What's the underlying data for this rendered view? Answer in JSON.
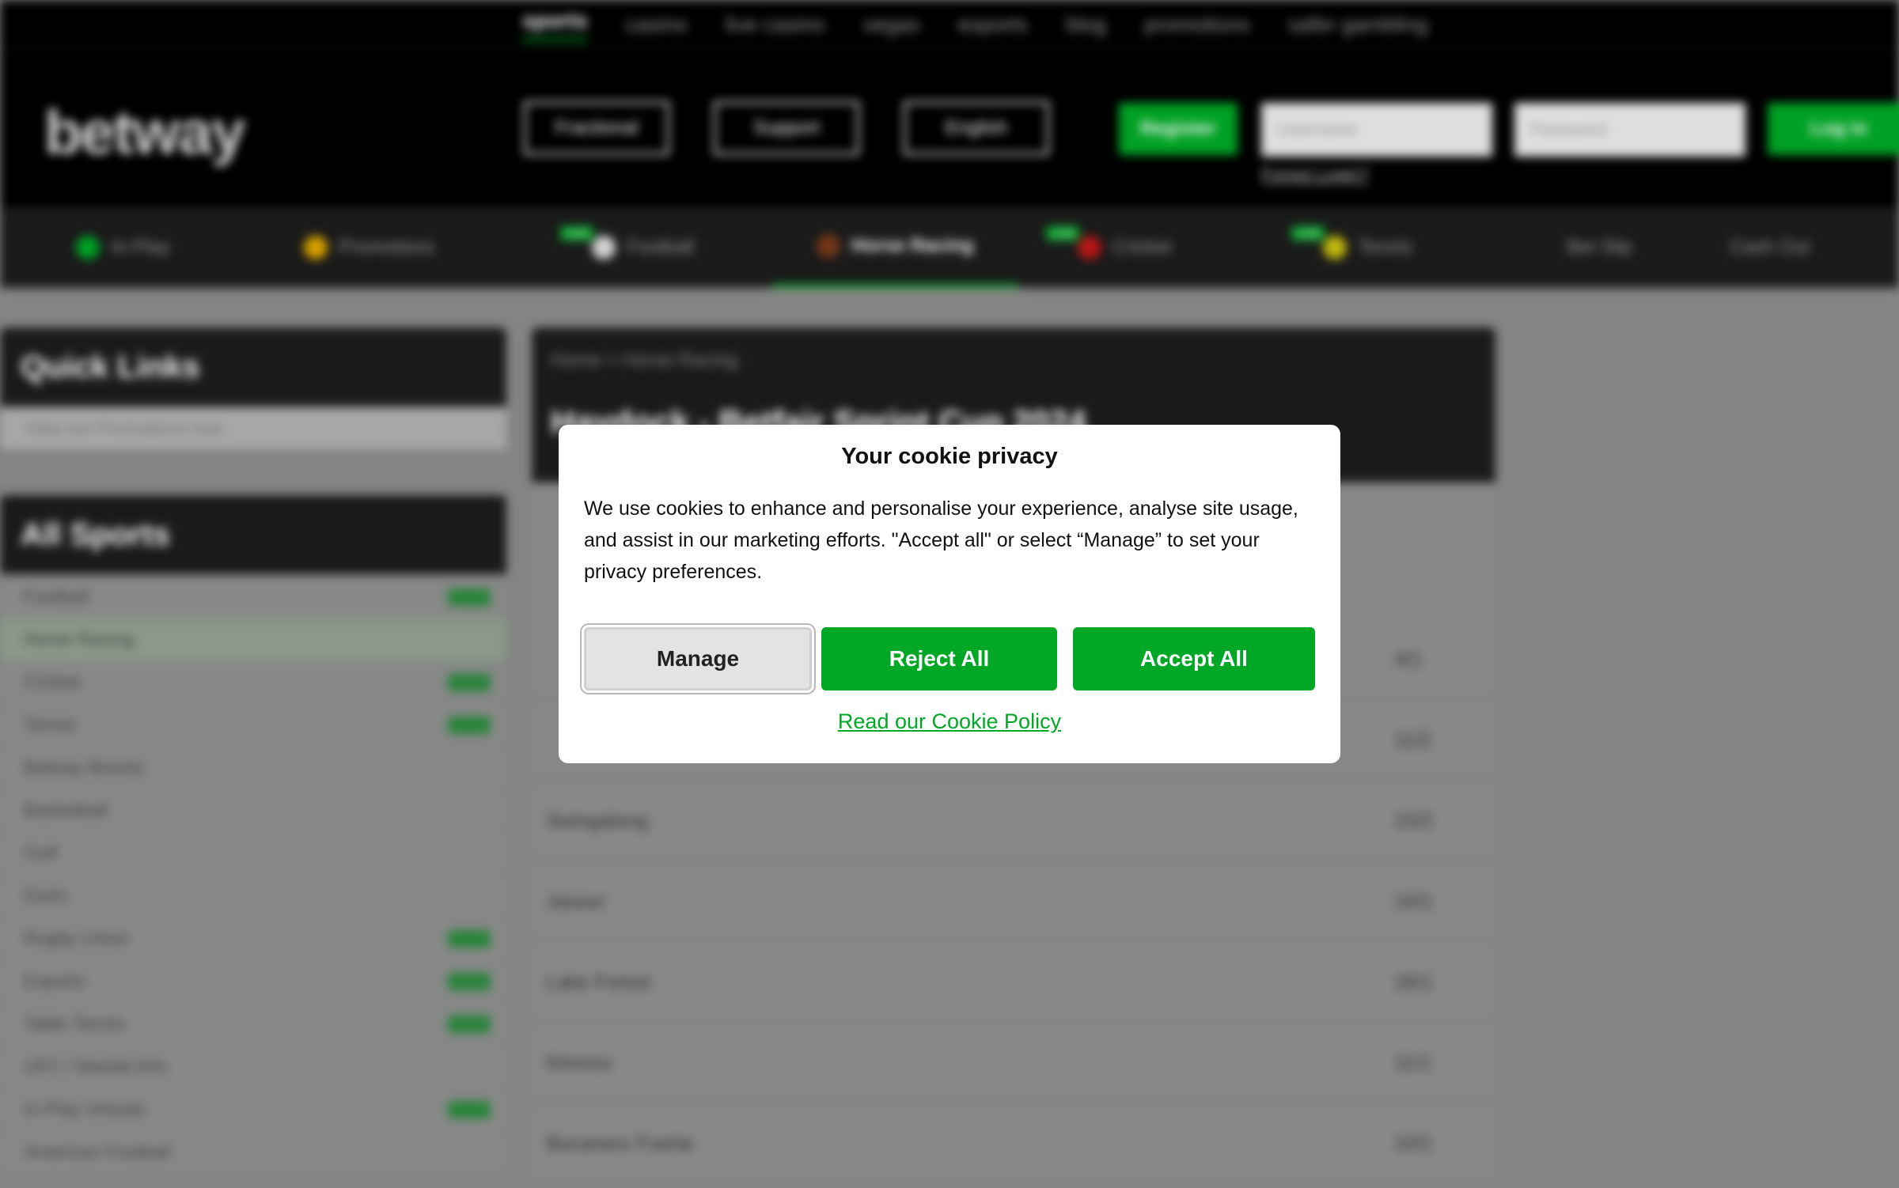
{
  "top_nav": [
    "sports",
    "casino",
    "live casino",
    "vegas",
    "esports",
    "blog",
    "promotions",
    "safer gambling"
  ],
  "header": {
    "logo": "betway",
    "odds_format": "Fractional",
    "support": "Support",
    "language": "English",
    "register": "Register",
    "username_placeholder": "Username",
    "password_placeholder": "Password",
    "login": "Log in",
    "forgot": "Forgot Login?"
  },
  "sports_bar": [
    "In-Play",
    "Promotions",
    "Football",
    "Horse Racing",
    "Cricket",
    "Tennis",
    "Bet Slip",
    "Cash Out"
  ],
  "live_badge": "LIVE",
  "quick_links": {
    "title": "Quick Links",
    "item": "View our Promotions now"
  },
  "all_sports": {
    "title": "All Sports",
    "items": [
      "Football",
      "Horse Racing",
      "Cricket",
      "Tennis",
      "Betway Boosts",
      "Basketball",
      "Golf",
      "Darts",
      "Rugby Union",
      "Esports",
      "Table Tennis",
      "UFC / Martial Arts",
      "In-Play Virtuals",
      "American Football"
    ]
  },
  "main": {
    "breadcrumb": "Home  >  Horse Racing",
    "title": "Haydock - Betfair Sprint Cup 2024",
    "runners": [
      {
        "name": "",
        "odds": "4/1"
      },
      {
        "name": "",
        "odds": "11/2"
      },
      {
        "name": "Swingalong",
        "odds": "15/2"
      },
      {
        "name": "Jasour",
        "odds": "10/1"
      },
      {
        "name": "Lake Forest",
        "odds": "16/1"
      },
      {
        "name": "Kinross",
        "odds": "11/1"
      },
      {
        "name": "Bucanero Fuerte",
        "odds": "10/1"
      }
    ]
  },
  "cookie_modal": {
    "title": "Your cookie privacy",
    "body": "We use cookies to enhance and personalise your experience, analyse site usage, and assist in our marketing efforts. \"Accept all\" or select “Manage” to set your privacy preferences.",
    "manage": "Manage",
    "reject": "Reject All",
    "accept": "Accept All",
    "policy_link": "Read our Cookie Policy"
  },
  "colors": {
    "brand_green": "#00a826",
    "header_black": "#000000"
  }
}
